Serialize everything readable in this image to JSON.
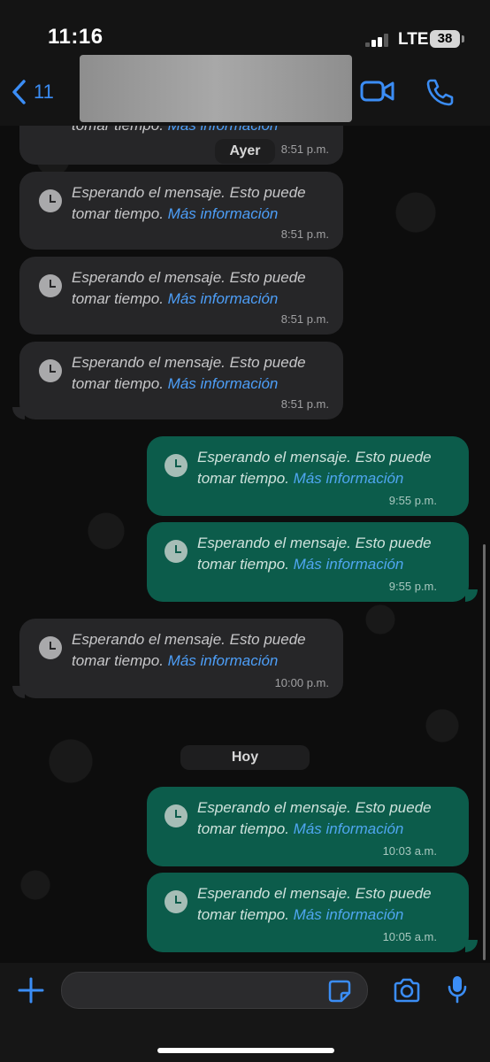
{
  "status_bar": {
    "time": "11:16",
    "network": "LTE",
    "battery": "38"
  },
  "header": {
    "back_count": "11",
    "back_icon": "chevron-left-icon",
    "video_icon": "video-camera-icon",
    "call_icon": "phone-icon"
  },
  "colors": {
    "accent": "#3b8df5",
    "incoming_bubble": "#262628",
    "outgoing_bubble": "#0c5c4b",
    "link": "#4d9ef7"
  },
  "chat": {
    "partial_message": {
      "text": "tomar tiempo.",
      "link": "Más información",
      "time": "8:51 p.m."
    },
    "date_yesterday": "Ayer",
    "date_today": "Hoy",
    "messages": [
      {
        "direction": "in",
        "text": "Esperando el mensaje. Esto puede tomar tiempo.",
        "link": "Más información",
        "time": "8:51 p.m."
      },
      {
        "direction": "in",
        "text": "Esperando el mensaje. Esto puede tomar tiempo.",
        "link": "Más información",
        "time": "8:51 p.m."
      },
      {
        "direction": "in",
        "text": "Esperando el mensaje. Esto puede tomar tiempo.",
        "link": "Más información",
        "time": "8:51 p.m."
      },
      {
        "direction": "out",
        "text": "Esperando el mensaje. Esto puede tomar tiempo.",
        "link": "Más información",
        "time": "9:55 p.m."
      },
      {
        "direction": "out",
        "text": "Esperando el mensaje. Esto puede tomar tiempo.",
        "link": "Más información",
        "time": "9:55 p.m."
      },
      {
        "direction": "in",
        "text": "Esperando el mensaje. Esto puede tomar tiempo.",
        "link": "Más información",
        "time": "10:00 p.m."
      },
      {
        "direction": "out",
        "text": "Esperando el mensaje. Esto puede tomar tiempo.",
        "link": "Más información",
        "time": "10:03 a.m."
      },
      {
        "direction": "out",
        "text": "Esperando el mensaje. Esto puede tomar tiempo.",
        "link": "Más información",
        "time": "10:05 a.m."
      }
    ]
  },
  "input_bar": {
    "placeholder": "",
    "icons": [
      "plus-icon",
      "sticker-icon",
      "camera-icon",
      "microphone-icon"
    ]
  }
}
